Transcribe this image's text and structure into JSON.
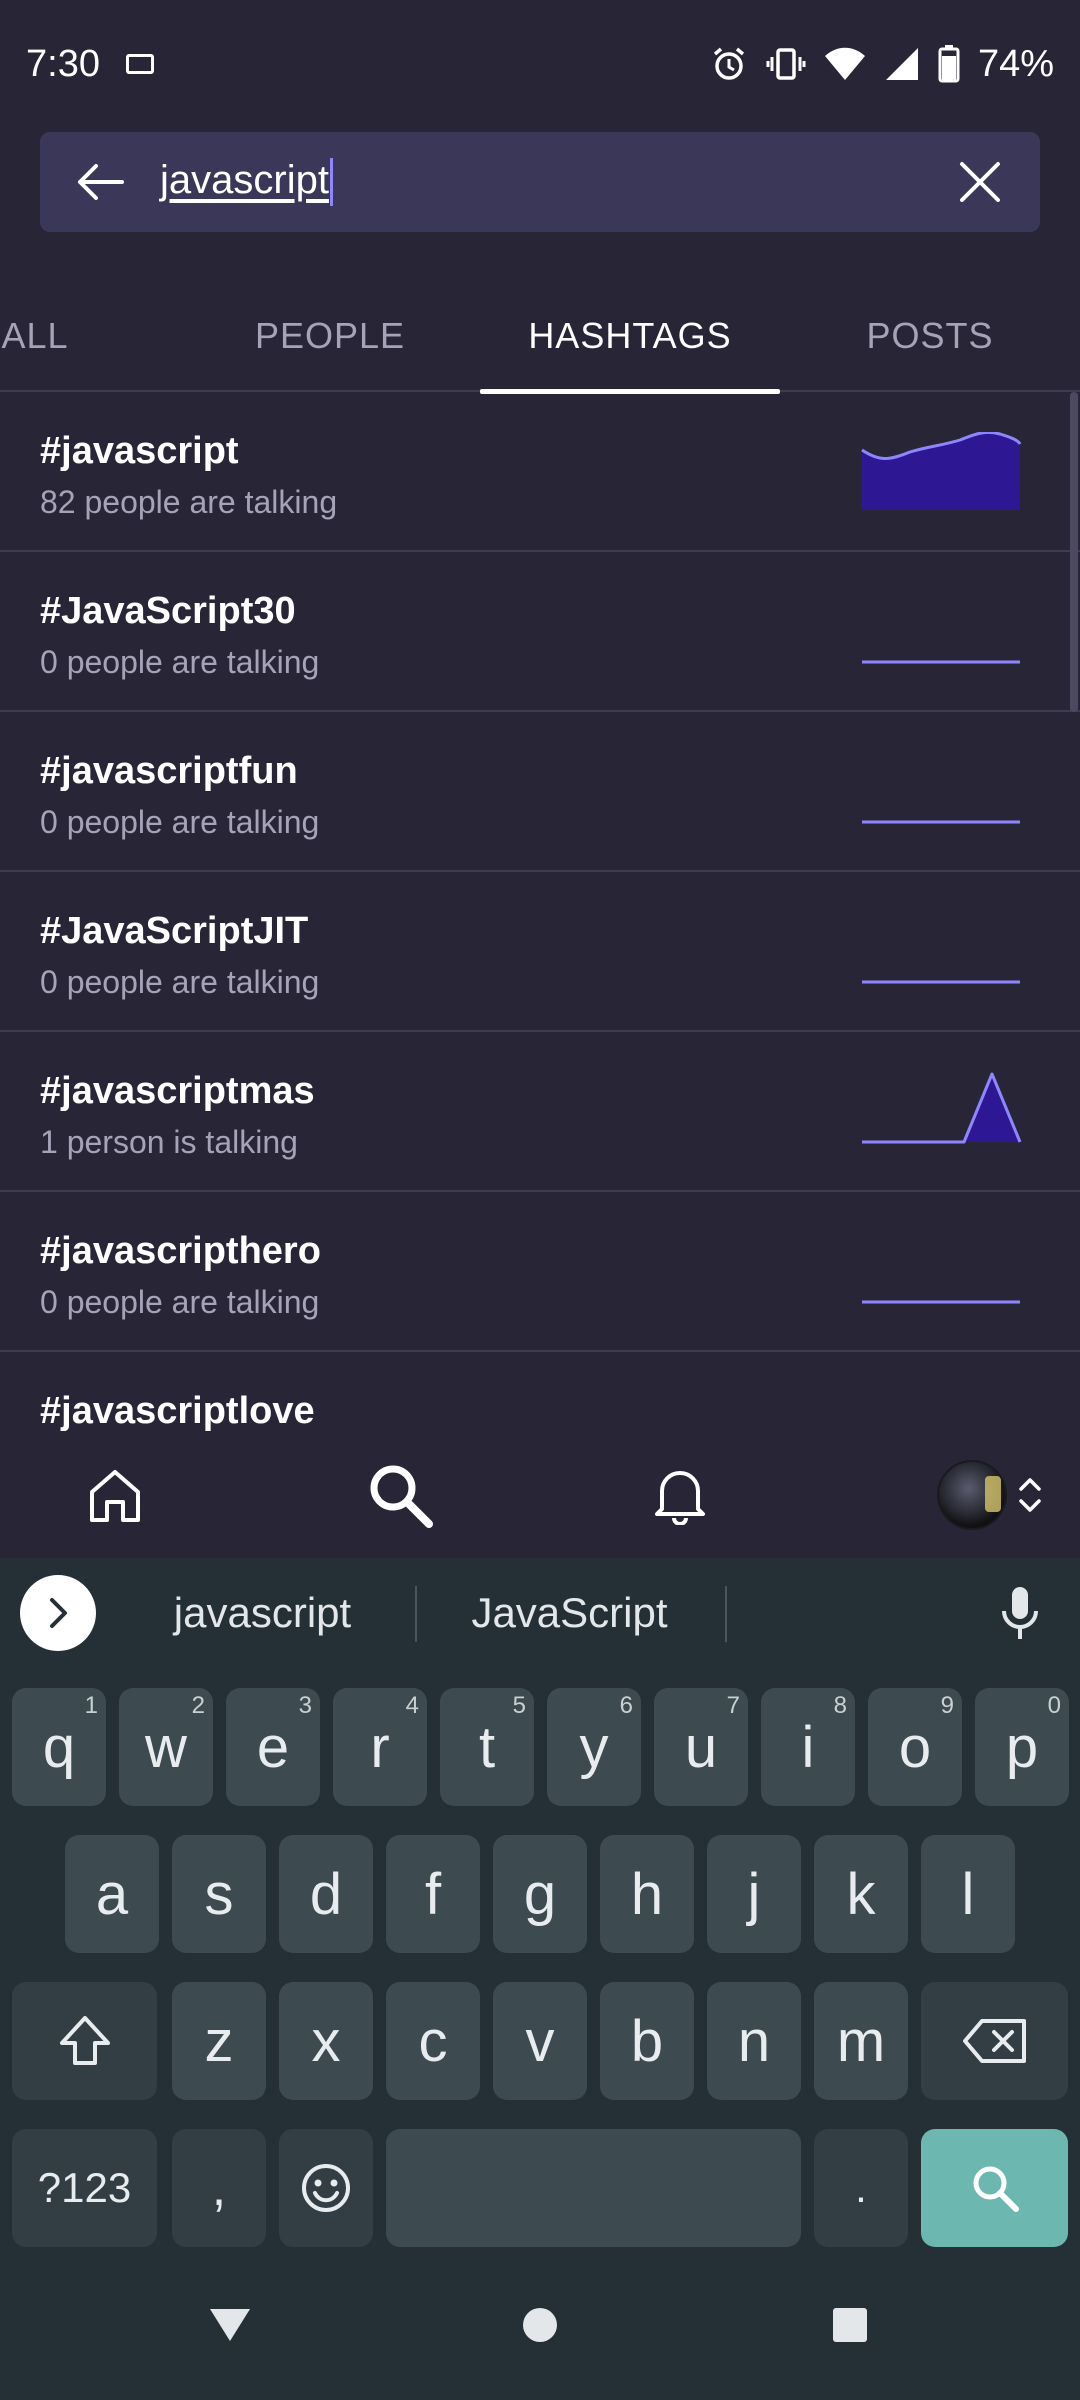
{
  "status_bar": {
    "time": "7:30",
    "battery_percent": "74%"
  },
  "search": {
    "query": "javascript"
  },
  "tabs": [
    {
      "label": "ALL",
      "active": false
    },
    {
      "label": "PEOPLE",
      "active": false
    },
    {
      "label": "HASHTAGS",
      "active": true
    },
    {
      "label": "POSTS",
      "active": false
    }
  ],
  "hashtags": [
    {
      "tag": "#javascript",
      "subtitle": "82 people are talking",
      "trend": "high"
    },
    {
      "tag": "#JavaScript30",
      "subtitle": "0 people are talking",
      "trend": "flat"
    },
    {
      "tag": "#javascriptfun",
      "subtitle": "0 people are talking",
      "trend": "flat"
    },
    {
      "tag": "#JavaScriptJIT",
      "subtitle": "0 people are talking",
      "trend": "flat"
    },
    {
      "tag": "#javascriptmas",
      "subtitle": "1 person is talking",
      "trend": "spike"
    },
    {
      "tag": "#javascripthero",
      "subtitle": "0 people are talking",
      "trend": "flat"
    },
    {
      "tag": "#javascriptlove",
      "subtitle": "",
      "trend": "none"
    }
  ],
  "bottom_nav": {
    "items": [
      "home-icon",
      "search-icon",
      "bell-icon",
      "avatar"
    ]
  },
  "keyboard": {
    "suggestions": [
      "javascript",
      "JavaScript"
    ],
    "row1": [
      {
        "k": "q",
        "h": "1"
      },
      {
        "k": "w",
        "h": "2"
      },
      {
        "k": "e",
        "h": "3"
      },
      {
        "k": "r",
        "h": "4"
      },
      {
        "k": "t",
        "h": "5"
      },
      {
        "k": "y",
        "h": "6"
      },
      {
        "k": "u",
        "h": "7"
      },
      {
        "k": "i",
        "h": "8"
      },
      {
        "k": "o",
        "h": "9"
      },
      {
        "k": "p",
        "h": "0"
      }
    ],
    "row2": [
      "a",
      "s",
      "d",
      "f",
      "g",
      "h",
      "j",
      "k",
      "l"
    ],
    "row3": [
      "z",
      "x",
      "c",
      "v",
      "b",
      "n",
      "m"
    ],
    "symbols_label": "?123",
    "comma": ",",
    "period": "."
  },
  "colors": {
    "background": "#282636",
    "accent": "#8f86ff",
    "chart_fill": "#2e1793",
    "keyboard_bg": "#253036",
    "search_key": "#6cb7b0"
  }
}
